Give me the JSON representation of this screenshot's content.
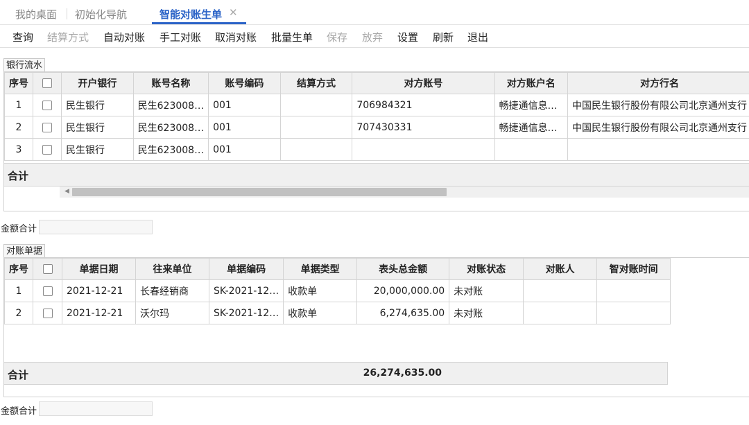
{
  "tabs": {
    "desktop": "我的桌面",
    "init_nav": "初始化导航",
    "active": "智能对账生单"
  },
  "toolbar": {
    "query": "查询",
    "settle_method": "结算方式",
    "auto_reconcile": "自动对账",
    "manual_reconcile": "手工对账",
    "cancel_reconcile": "取消对账",
    "batch_generate": "批量生单",
    "save": "保存",
    "discard": "放弃",
    "settings": "设置",
    "refresh": "刷新",
    "exit": "退出"
  },
  "bank": {
    "section_label": "银行流水",
    "columns": [
      "序号",
      "",
      "开户银行",
      "账号名称",
      "账号编码",
      "结算方式",
      "对方账号",
      "对方账户名",
      "对方行名"
    ],
    "rows": [
      {
        "no": "1",
        "bank": "民生银行",
        "acct_name": "民生623008…",
        "acct_code": "001",
        "settle": "",
        "opp_acct": "706984321",
        "opp_name": "畅捷通信息…",
        "opp_bank": "中国民生银行股份有限公司北京通州支行"
      },
      {
        "no": "2",
        "bank": "民生银行",
        "acct_name": "民生623008…",
        "acct_code": "001",
        "settle": "",
        "opp_acct": "707430331",
        "opp_name": "畅捷通信息…",
        "opp_bank": "中国民生银行股份有限公司北京通州支行"
      },
      {
        "no": "3",
        "bank": "民生银行",
        "acct_name": "民生623008…",
        "acct_code": "001",
        "settle": "",
        "opp_acct": "",
        "opp_name": "",
        "opp_bank": ""
      }
    ],
    "total_label": "合计",
    "sum_label": "金额合计",
    "sum_value": ""
  },
  "docs": {
    "section_label": "对账单据",
    "columns": [
      "序号",
      "",
      "单据日期",
      "往来单位",
      "单据编码",
      "单据类型",
      "表头总金额",
      "对账状态",
      "对账人",
      "智对账时间"
    ],
    "rows": [
      {
        "no": "1",
        "date": "2021-12-21",
        "unit": "长春经销商",
        "code": "SK-2021-12…",
        "type": "收款单",
        "amount": "20,000,000.00",
        "status": "未对账",
        "person": "",
        "time": ""
      },
      {
        "no": "2",
        "date": "2021-12-21",
        "unit": "沃尔玛",
        "code": "SK-2021-12…",
        "type": "收款单",
        "amount": "6,274,635.00",
        "status": "未对账",
        "person": "",
        "time": ""
      }
    ],
    "total_label": "合计",
    "total_amount": "26,274,635.00",
    "sum_label": "金额合计",
    "sum_value": ""
  }
}
